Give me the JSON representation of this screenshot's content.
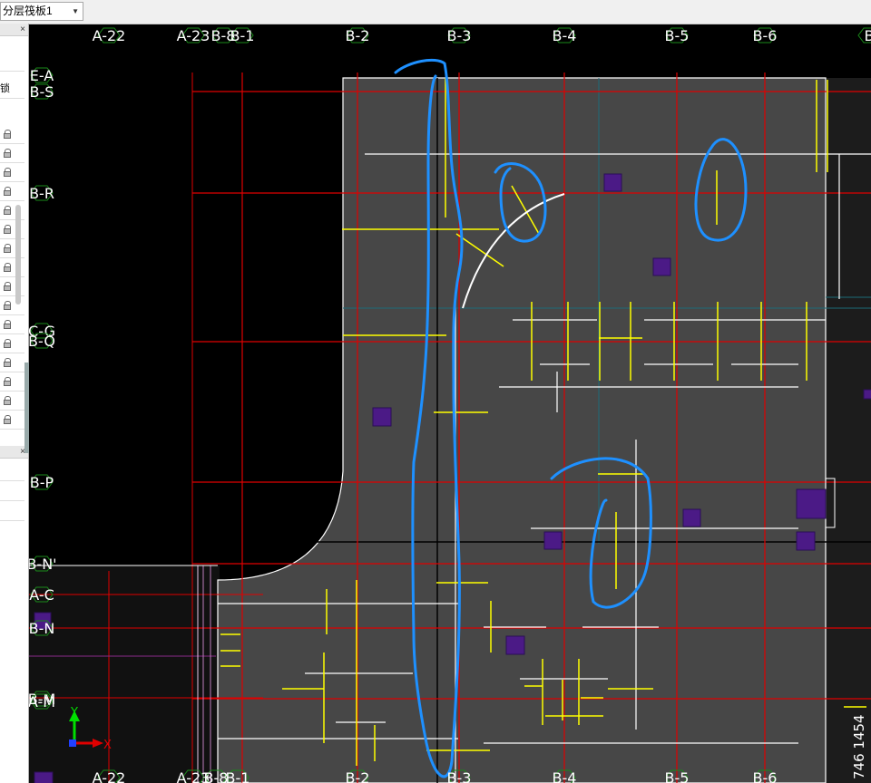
{
  "toolbar": {
    "layer_select_value": "分层筏板1"
  },
  "left_panel": {
    "close_symbol": "×",
    "row_partial_text": "锁",
    "lock_icon_count": 16
  },
  "cad": {
    "top_axis_labels": [
      "A-22",
      "A-23",
      "B-8",
      "B-1",
      "B-2",
      "B-3",
      "B-4",
      "B-5",
      "B-6",
      "B"
    ],
    "bottom_axis_labels": [
      "A-22",
      "A-23",
      "B-8",
      "B-1",
      "B-2",
      "B-3",
      "B-4",
      "B-5",
      "B-6"
    ],
    "left_axis_labels": [
      "E-A",
      "B-S",
      "B-R",
      "C-G",
      "B-Q",
      "B-P",
      "B-N'",
      "A-C",
      "B-N",
      "B-M",
      "A-M"
    ],
    "coordinate_icon": {
      "x_label": "X",
      "y_label": "Y"
    },
    "right_edge_dimension": "746 1454",
    "colors": {
      "background": "#000000",
      "slab_fill": "#474747",
      "axis_line": "#e00000",
      "rebar": "#ffff00",
      "white_line": "#ffffff",
      "markup": "#1e90ff",
      "column": "#4b1a86",
      "grid_hex": "#1a8a1a"
    }
  }
}
